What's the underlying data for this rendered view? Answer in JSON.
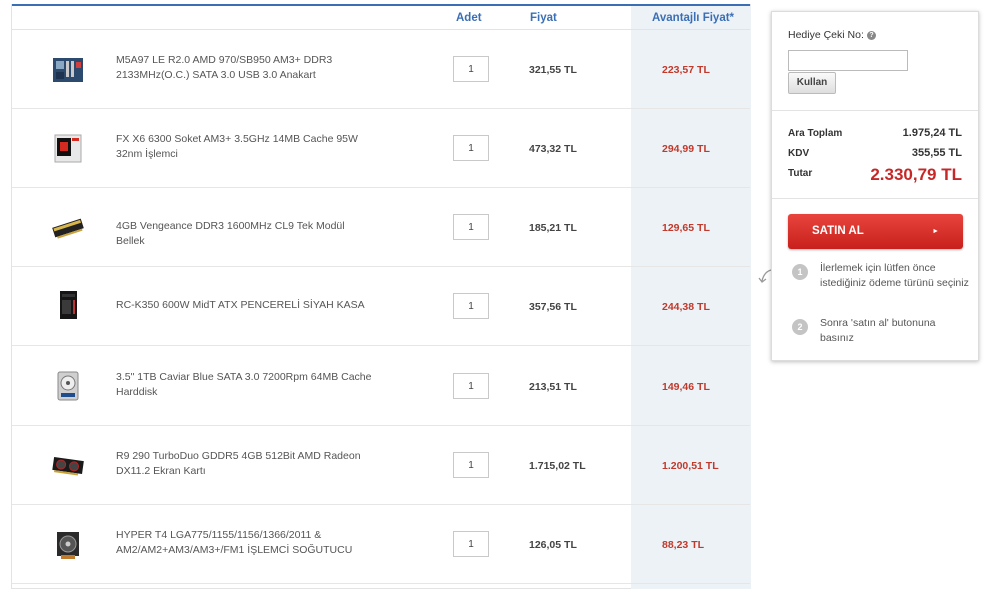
{
  "table": {
    "headers": {
      "adet": "Adet",
      "fiyat": "Fiyat",
      "avantajli": "Avantajlı Fiyat*"
    },
    "rows": [
      {
        "name": "M5A97 LE R2.0 AMD 970/SB950 AM3+ DDR3 2133MHz(O.C.) SATA 3.0 USB 3.0 Anakart",
        "qty": "1",
        "price": "321,55 TL",
        "adv_price": "223,57 TL",
        "icon": "motherboard-icon"
      },
      {
        "name": "FX X6 6300 Soket AM3+ 3.5GHz 14MB Cache 95W 32nm İşlemci",
        "qty": "1",
        "price": "473,32 TL",
        "adv_price": "294,99 TL",
        "icon": "cpu-box-icon"
      },
      {
        "name": "4GB Vengeance DDR3 1600MHz CL9 Tek Modül Bellek",
        "qty": "1",
        "price": "185,21 TL",
        "adv_price": "129,65 TL",
        "icon": "ram-icon"
      },
      {
        "name": "RC-K350 600W MidT ATX PENCERELİ SİYAH KASA",
        "qty": "1",
        "price": "357,56 TL",
        "adv_price": "244,38 TL",
        "icon": "pc-case-icon"
      },
      {
        "name": "3.5\" 1TB Caviar Blue SATA 3.0 7200Rpm 64MB Cache Harddisk",
        "qty": "1",
        "price": "213,51 TL",
        "adv_price": "149,46 TL",
        "icon": "hard-disk-icon"
      },
      {
        "name": "R9 290 TurboDuo GDDR5 4GB 512Bit AMD Radeon DX11.2 Ekran Kartı",
        "qty": "1",
        "price": "1.715,02 TL",
        "adv_price": "1.200,51 TL",
        "icon": "graphics-card-icon"
      },
      {
        "name": "HYPER T4 LGA775/1155/1156/1366/2011 & AM2/AM2+AM3/AM3+/FM1 İŞLEMCİ SOĞUTUCU",
        "qty": "1",
        "price": "126,05 TL",
        "adv_price": "88,23 TL",
        "icon": "cpu-cooler-icon"
      }
    ]
  },
  "summary": {
    "gift_label": "Hediye Çeki No:",
    "gift_value": "",
    "use_button": "Kullan",
    "subtotal_label": "Ara Toplam",
    "subtotal_value": "1.975,24 TL",
    "tax_label": "KDV",
    "tax_value": "355,55 TL",
    "total_label": "Tutar",
    "total_value": "2.330,79 TL",
    "buy_button": "SATIN AL",
    "steps": [
      {
        "num": "1",
        "text": "İlerlemek için lütfen önce istediğiniz ödeme türünü seçiniz"
      },
      {
        "num": "2",
        "text": "Sonra 'satın al' butonuna basınız"
      }
    ]
  },
  "colors": {
    "accent_blue": "#3a6fb5",
    "price_red": "#c0392b",
    "buy_red": "#d9302a"
  }
}
